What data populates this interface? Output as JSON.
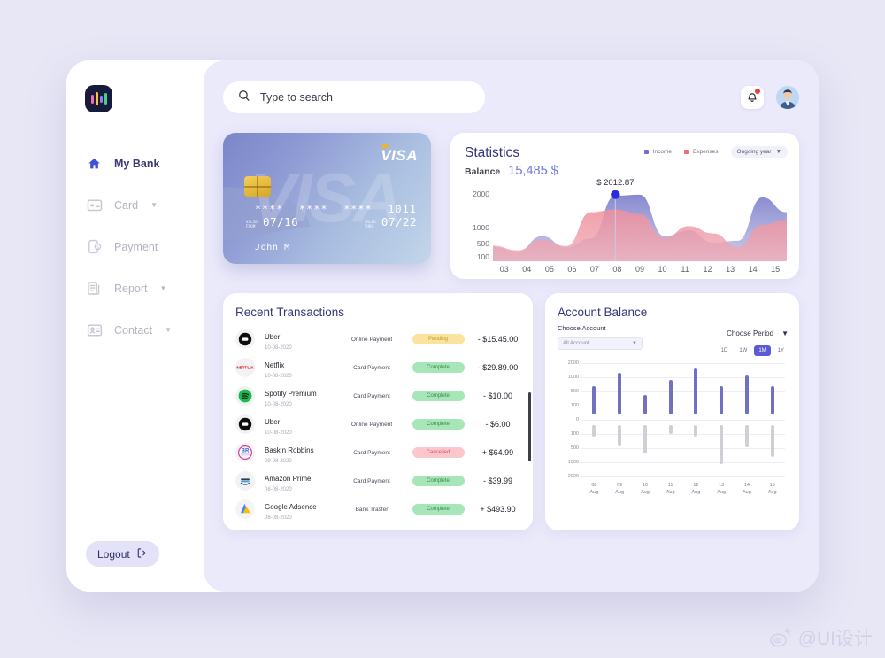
{
  "brand": {
    "logo_name": "bank-logo",
    "colors": {
      "accent": "#5b5bd6",
      "income": "#7071c4",
      "expenses": "#ef8a96",
      "complete": "#8fe0a6",
      "pending": "#fae3a0",
      "cancelled": "#fbc7cc"
    }
  },
  "search": {
    "placeholder": "Type to search",
    "value": "",
    "icon": "search-icon"
  },
  "header": {
    "bell_icon": "bell-icon",
    "avatar_icon": "user-avatar"
  },
  "sidebar": {
    "items": [
      {
        "label": "My Bank",
        "icon": "home-icon",
        "active": true,
        "caret": ""
      },
      {
        "label": "Card",
        "icon": "card-icon",
        "active": false,
        "caret": "▼"
      },
      {
        "label": "Payment",
        "icon": "payment-icon",
        "active": false,
        "caret": ""
      },
      {
        "label": "Report",
        "icon": "report-icon",
        "active": false,
        "caret": "▼"
      },
      {
        "label": "Contact",
        "icon": "contact-icon",
        "active": false,
        "caret": "▼"
      }
    ],
    "logout": {
      "label": "Logout",
      "icon": "logout-icon"
    }
  },
  "credit_card": {
    "brand": "VISA",
    "watermark": "VISA",
    "number_groups": [
      "****",
      "****",
      "****",
      "1011"
    ],
    "valid_from_label": "VALID\nFROM",
    "valid_from": "07/16",
    "valid_thru_label": "VALID\nTHRU",
    "valid_thru": "07/22",
    "holder": "John M"
  },
  "statistics": {
    "title": "Statistics",
    "balance_label": "Balance",
    "balance_value": "15,485 $",
    "period_selector": "Ongoing year",
    "legend": [
      {
        "label": "Income",
        "color": "#7071c4"
      },
      {
        "label": "Expenses",
        "color": "#ef6b78"
      }
    ],
    "tooltip": "$ 2012.87",
    "chart_data": {
      "type": "area",
      "title": "Statistics",
      "xlabel": "",
      "ylabel": "",
      "ylim": [
        0,
        2300
      ],
      "yticks": [
        2000,
        1000,
        500,
        100
      ],
      "ytick_labels": [
        "2000",
        "1000",
        "500",
        "100"
      ],
      "categories": [
        "03",
        "04",
        "05",
        "06",
        "07",
        "08",
        "09",
        "10",
        "11",
        "12",
        "13",
        "14",
        "15"
      ],
      "grid": false,
      "legend_position": "top-right",
      "annotation": {
        "label": "$ 2012.87",
        "x": "08",
        "y": 2012.87
      },
      "series": [
        {
          "name": "Income",
          "color": "#7071c4",
          "values": [
            430,
            300,
            760,
            420,
            690,
            1980,
            2010,
            760,
            930,
            560,
            620,
            1930,
            1480
          ]
        },
        {
          "name": "Expenses",
          "color": "#ef6b78",
          "values": [
            470,
            330,
            650,
            460,
            1480,
            1560,
            1420,
            700,
            1060,
            840,
            430,
            1100,
            1250
          ]
        }
      ]
    }
  },
  "transactions": {
    "title": "Recent Transactions",
    "rows": [
      {
        "merchant": "Uber",
        "date": "10-08-2020",
        "type": "Online Payment",
        "status": "Pending",
        "status_kind": "pending",
        "amount": "- $15.45.00",
        "icon": "uber-icon"
      },
      {
        "merchant": "Netflix",
        "date": "10-08-2020",
        "type": "Card Payment",
        "status": "Complete",
        "status_kind": "complete",
        "amount": "- $29.89.00",
        "icon": "netflix-icon"
      },
      {
        "merchant": "Spotify Premium",
        "date": "10-08-2020",
        "type": "Card Payment",
        "status": "Complete",
        "status_kind": "complete",
        "amount": "- $10.00",
        "icon": "spotify-icon"
      },
      {
        "merchant": "Uber",
        "date": "10-08-2020",
        "type": "Online Payment",
        "status": "Complete",
        "status_kind": "complete",
        "amount": "- $6.00",
        "icon": "uber-icon"
      },
      {
        "merchant": "Baskin Robbins",
        "date": "09-08-2020",
        "type": "Card Payment",
        "status": "Cancelled",
        "status_kind": "cancelled",
        "amount": "+ $64.99",
        "icon": "baskin-robbins-icon"
      },
      {
        "merchant": "Amazon Prime",
        "date": "08-08-2020",
        "type": "Card Payment",
        "status": "Complete",
        "status_kind": "complete",
        "amount": "- $39.99",
        "icon": "amazon-prime-icon"
      },
      {
        "merchant": "Google Adsence",
        "date": "08-08-2020",
        "type": "Bank Trasfer",
        "status": "Complete",
        "status_kind": "complete",
        "amount": "+ $493.90",
        "icon": "google-adsense-icon"
      }
    ]
  },
  "account_balance": {
    "title": "Account Balance",
    "choose_account_label": "Choose Account",
    "account_value": "All Account",
    "choose_period_label": "Choose Period",
    "periods": [
      {
        "label": "1D",
        "active": false
      },
      {
        "label": "1W",
        "active": false
      },
      {
        "label": "1M",
        "active": true
      },
      {
        "label": "1Y",
        "active": false
      }
    ],
    "chart_data": {
      "type": "bar",
      "title": "Account Balance",
      "xlabel": "",
      "ylabel": "",
      "grid": true,
      "ytick_labels": [
        "2000",
        "1000",
        "500",
        "100",
        "0",
        "100",
        "500",
        "1000",
        "2000"
      ],
      "categories": [
        "08 Aug",
        "09 Aug",
        "10 Aug",
        "11 Aug",
        "12 Aug",
        "13 Aug",
        "14 Aug",
        "15 Aug"
      ],
      "series": [
        {
          "name": "Credit",
          "color": "#7071c4",
          "values": [
            700,
            1300,
            400,
            900,
            1600,
            700,
            1100,
            700
          ]
        },
        {
          "name": "Debit",
          "color": "#cfcfd6",
          "values": [
            -180,
            -450,
            -700,
            -110,
            -180,
            -1100,
            -480,
            -800
          ]
        }
      ]
    }
  },
  "watermark": {
    "text": "@UI设计",
    "icon": "weibo-icon"
  }
}
